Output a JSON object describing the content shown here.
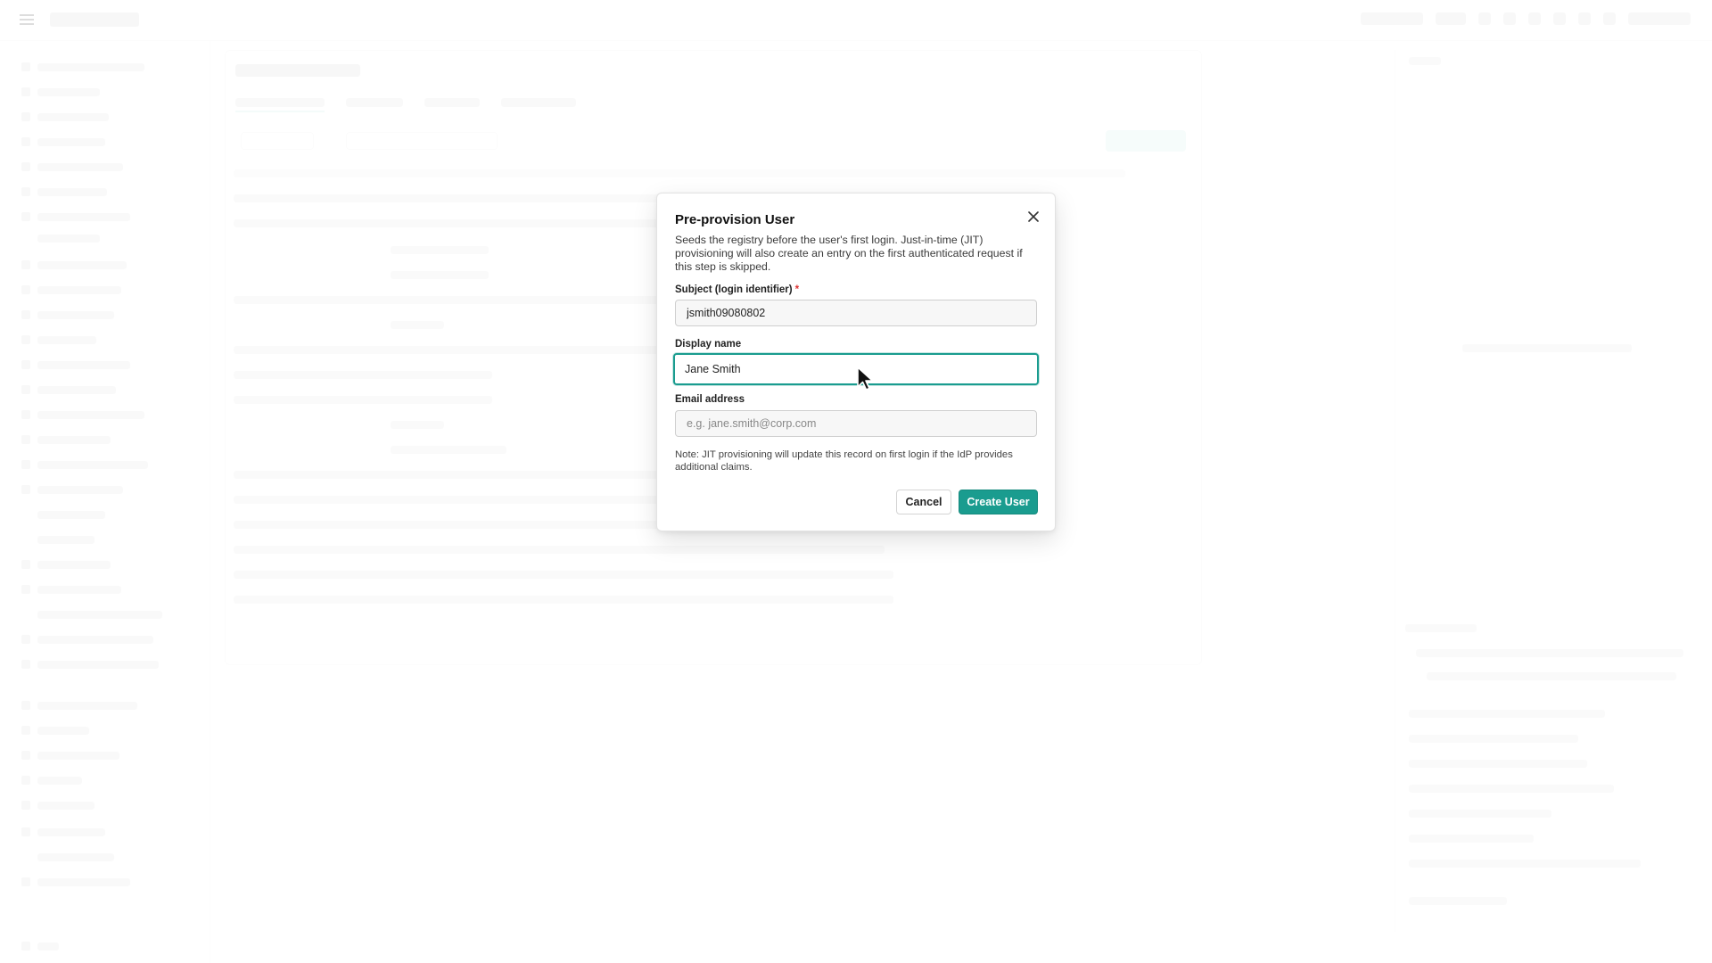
{
  "dialog": {
    "title": "Pre-provision User",
    "description": "Seeds the registry before the user's first login. Just-in-time (JIT) provisioning will also create an entry on the first authenticated request if this step is skipped.",
    "fields": {
      "subject": {
        "label": "Subject (login identifier)",
        "required_marker": "*",
        "value": "jsmith09080802"
      },
      "display_name": {
        "label": "Display name",
        "value": "Jane Smith"
      },
      "email": {
        "label": "Email address",
        "value": "",
        "placeholder": "e.g. jane.smith@corp.com"
      }
    },
    "note": "Note: JIT provisioning will update this record on first login if the IdP provides additional claims.",
    "buttons": {
      "cancel": "Cancel",
      "create": "Create User"
    }
  },
  "icons": {
    "close": "close-icon",
    "cursor": "mouse-pointer-icon",
    "menu": "menu-icon"
  },
  "colors": {
    "accent": "#1a9c8f",
    "required": "#dd3333",
    "overlay": "rgba(255,255,255,0.82)"
  }
}
